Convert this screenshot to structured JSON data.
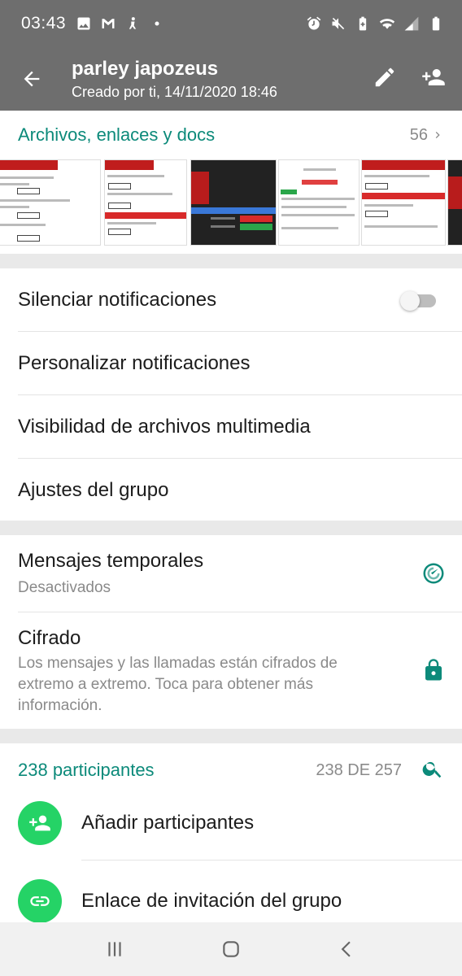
{
  "status_bar": {
    "time": "03:43",
    "left_icons": [
      "image-icon",
      "gmail-icon",
      "activity-icon",
      "dot-icon"
    ],
    "right_icons": [
      "alarm-icon",
      "mute-icon",
      "battery-saver-icon",
      "wifi-icon",
      "signal-icon",
      "battery-icon"
    ]
  },
  "app_bar": {
    "title": "parley japozeus",
    "subtitle": "Creado por ti, 14/11/2020 18:46",
    "actions": [
      "edit-icon",
      "add-participant-icon"
    ]
  },
  "media": {
    "title": "Archivos, enlaces y docs",
    "count": "56"
  },
  "settings": {
    "mute": "Silenciar notificaciones",
    "mute_enabled": false,
    "custom_notifications": "Personalizar notificaciones",
    "media_visibility": "Visibilidad de archivos multimedia",
    "group_settings": "Ajustes del grupo"
  },
  "privacy": {
    "disappearing_title": "Mensajes temporales",
    "disappearing_value": "Desactivados",
    "encryption_title": "Cifrado",
    "encryption_text": "Los mensajes y las llamadas están cifrados de extremo a extremo. Toca para obtener más información."
  },
  "participants": {
    "title": "238 participantes",
    "count": "238 DE 257",
    "add": "Añadir participantes",
    "invite_link": "Enlace de invitación del grupo"
  },
  "colors": {
    "accent": "#0c8a7a",
    "bar": "#6e6e6e",
    "green_avatar": "#25d366"
  }
}
